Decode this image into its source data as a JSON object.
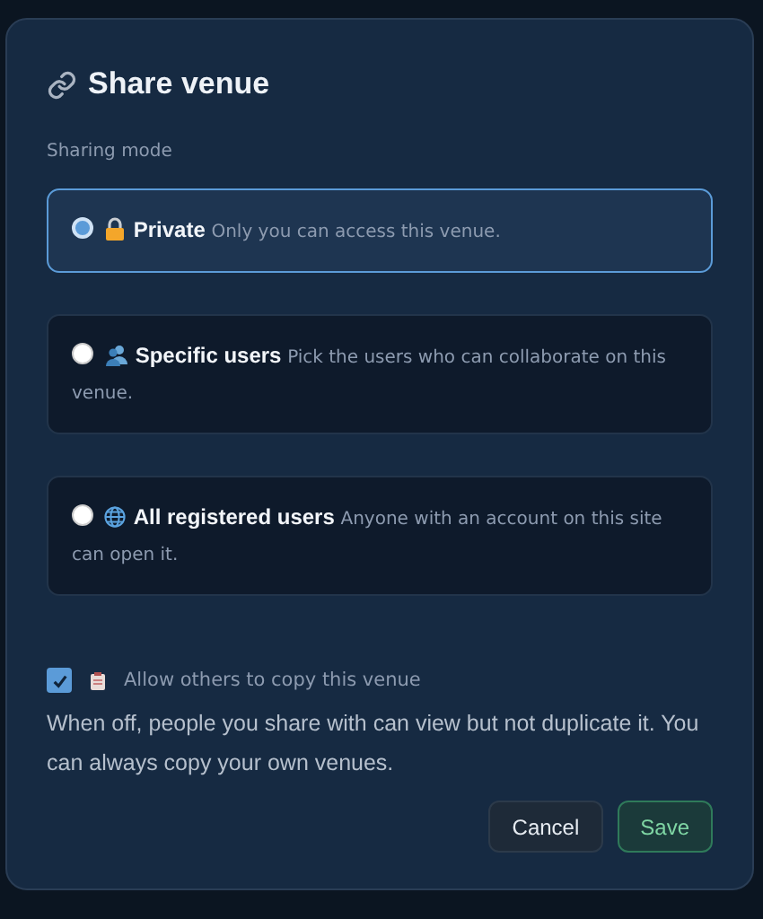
{
  "dialog": {
    "title": "Share venue"
  },
  "section_label": "Sharing mode",
  "options": [
    {
      "kind": "lock",
      "label": "Private",
      "description": "Only you can access this venue.",
      "selected": true
    },
    {
      "kind": "users",
      "label": "Specific users",
      "description": "Pick the users who can collaborate on this venue.",
      "selected": false
    },
    {
      "kind": "globe",
      "label": "All registered users",
      "description": "Anyone with an account on this site can open it.",
      "selected": false
    }
  ],
  "copy_option": {
    "label": "Allow others to copy this venue",
    "checked": true
  },
  "help_text": "When off, people you share with can view but not duplicate it. You can always copy your own venues.",
  "buttons": [
    {
      "kind": "secondary",
      "label": "Cancel"
    },
    {
      "kind": "primary",
      "label": "Save"
    }
  ]
}
